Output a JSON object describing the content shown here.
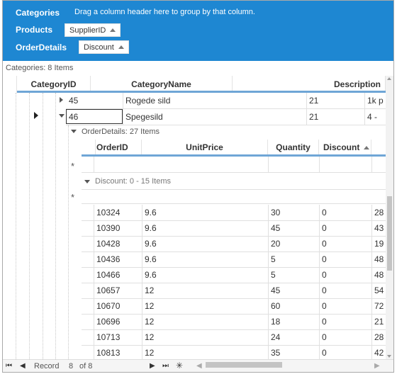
{
  "group_panel": {
    "bands": [
      {
        "title": "Categories",
        "hint": "Drag a column header here to group by that column."
      },
      {
        "title": "Products",
        "chip": "SupplierID"
      },
      {
        "title": "OrderDetails",
        "chip": "Discount"
      }
    ]
  },
  "categories_status": "Categories: 8 Items",
  "columns": {
    "category_id": "CategoryID",
    "category_name": "CategoryName",
    "description": "Description"
  },
  "product_rows": [
    {
      "id": "45",
      "name": "Rogede sild",
      "supplier": "21",
      "desc": "1k p"
    },
    {
      "id": "46",
      "name": "Spegesild",
      "supplier": "21",
      "desc": "4 - "
    }
  ],
  "order_details_status": "OrderDetails: 27 Items",
  "od_columns": {
    "order_id": "OrderID",
    "unit_price": "UnitPrice",
    "quantity": "Quantity",
    "discount": "Discount"
  },
  "discount_group": "Discount: 0 - 15 Items",
  "new_row_symbol": "*",
  "order_rows": [
    {
      "order_id": "10324",
      "unit_price": "9.6",
      "quantity": "30",
      "discount": "0",
      "extra": "28"
    },
    {
      "order_id": "10390",
      "unit_price": "9.6",
      "quantity": "45",
      "discount": "0",
      "extra": "43"
    },
    {
      "order_id": "10428",
      "unit_price": "9.6",
      "quantity": "20",
      "discount": "0",
      "extra": "19"
    },
    {
      "order_id": "10436",
      "unit_price": "9.6",
      "quantity": "5",
      "discount": "0",
      "extra": "48"
    },
    {
      "order_id": "10466",
      "unit_price": "9.6",
      "quantity": "5",
      "discount": "0",
      "extra": "48"
    },
    {
      "order_id": "10657",
      "unit_price": "12",
      "quantity": "45",
      "discount": "0",
      "extra": "54"
    },
    {
      "order_id": "10670",
      "unit_price": "12",
      "quantity": "60",
      "discount": "0",
      "extra": "72"
    },
    {
      "order_id": "10696",
      "unit_price": "12",
      "quantity": "18",
      "discount": "0",
      "extra": "21"
    },
    {
      "order_id": "10713",
      "unit_price": "12",
      "quantity": "24",
      "discount": "0",
      "extra": "28"
    },
    {
      "order_id": "10813",
      "unit_price": "12",
      "quantity": "35",
      "discount": "0",
      "extra": "42"
    }
  ],
  "navigator": {
    "record_label": "Record",
    "current": "8",
    "of_label": "of 8"
  },
  "colors": {
    "group_panel_bg": "#1e87d2",
    "header_underline": "#6fa6d6"
  }
}
